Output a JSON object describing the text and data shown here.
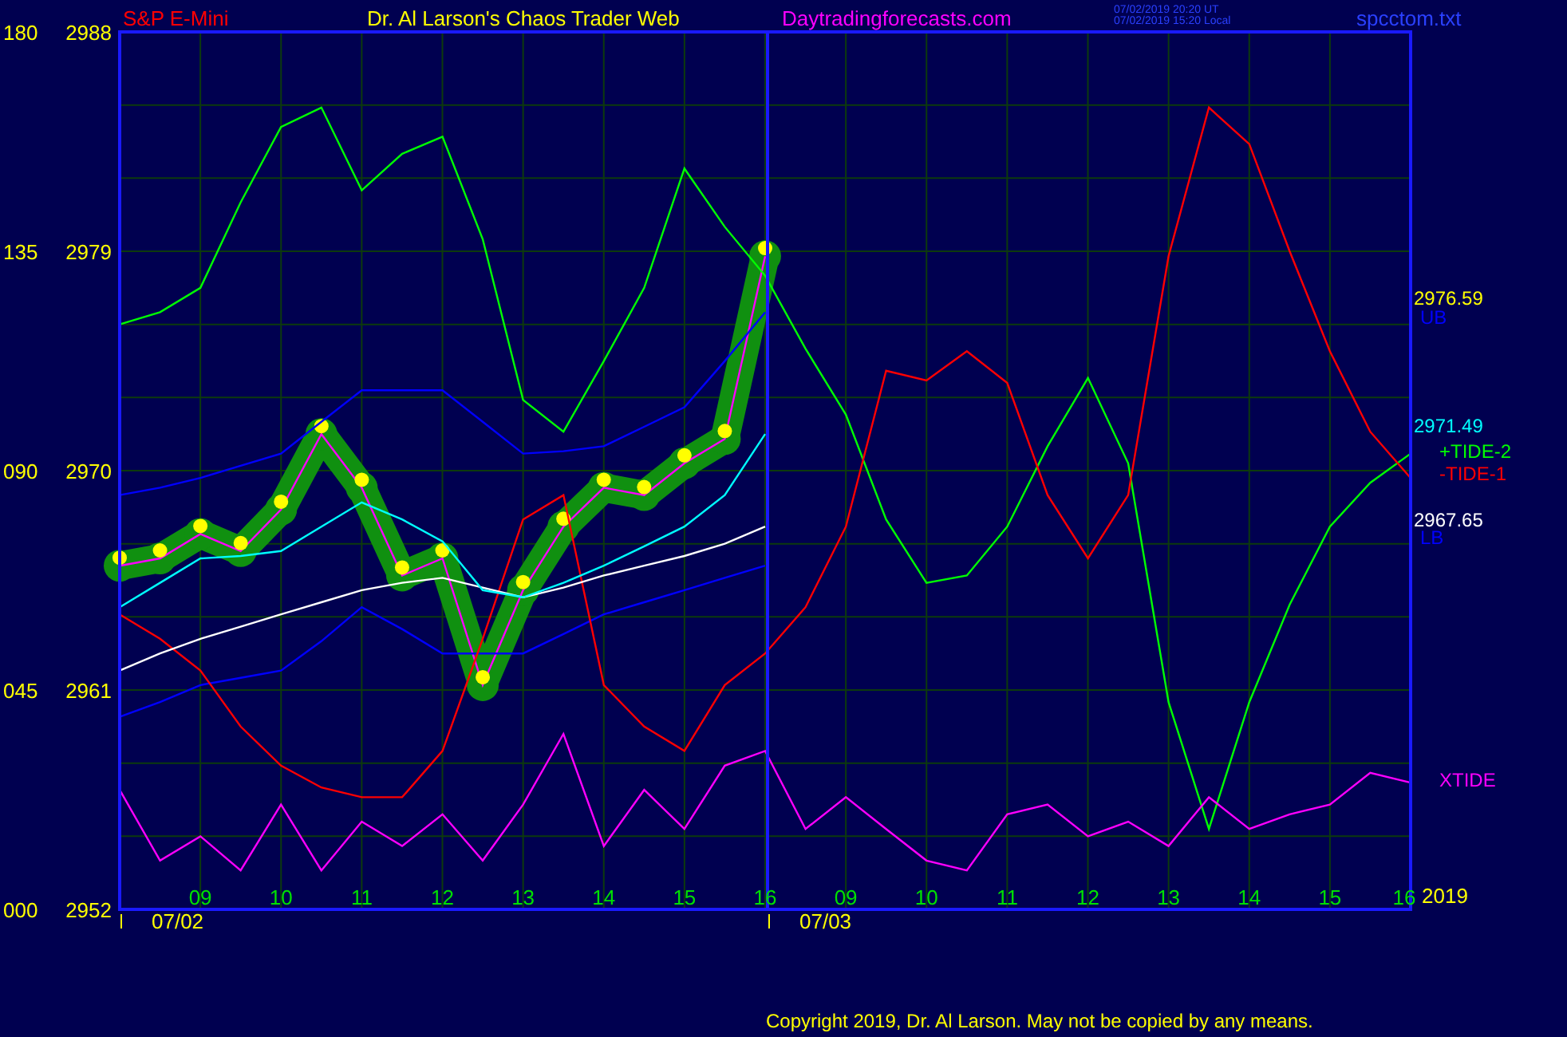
{
  "header": {
    "symbol": "S&P E-Mini",
    "title": "Dr. Al Larson's Chaos Trader Web",
    "site": "Daytradingforecasts.com",
    "times": [
      "07/02/2019 20:20 UT",
      "07/02/2019 15:20 Local"
    ],
    "file": "spcctom.txt"
  },
  "chart_data": {
    "type": "line",
    "ylim": [
      2952,
      2988
    ],
    "categories": [
      null,
      null,
      "09",
      null,
      "10",
      null,
      "11",
      null,
      "12",
      null,
      "13",
      null,
      "14",
      null,
      "15",
      null,
      "16",
      null,
      "09",
      null,
      "10",
      null,
      "11",
      null,
      "12",
      null,
      "13",
      null,
      "14",
      null,
      "15",
      null,
      "16"
    ],
    "yticks": [
      2952,
      2961,
      2970,
      2979,
      2988
    ],
    "grid": true,
    "series": [
      {
        "name": "UB",
        "color": "#0000ff",
        "values": [
          2969.0,
          2969.3,
          2969.7,
          2970.2,
          2970.7,
          2972,
          2973.3,
          2973.3,
          2973.3,
          2972.0,
          2970.7,
          2970.8,
          2971.0,
          2971.8,
          2972.6,
          2974.5,
          2976.5,
          null,
          null,
          null,
          null,
          null,
          null,
          null,
          null,
          null,
          null,
          null,
          null,
          null,
          null,
          null,
          null
        ]
      },
      {
        "name": "LB",
        "color": "#0000ff",
        "values": [
          2959.9,
          2960.5,
          2961.2,
          2961.5,
          2961.8,
          2963,
          2964.4,
          2963.5,
          2962.5,
          2962.5,
          2962.5,
          2963.3,
          2964.1,
          2964.6,
          2965.1,
          2965.6,
          2966.1,
          null,
          null,
          null,
          null,
          null,
          null,
          null,
          null,
          null,
          null,
          null,
          null,
          null,
          null,
          null,
          null
        ]
      },
      {
        "name": "+TIDE-2",
        "color": "#00ff00",
        "values": [
          2976.0,
          2976.5,
          2977.5,
          2981,
          2984.1,
          2984.9,
          2981.5,
          2983,
          2983.7,
          2979.5,
          2972.9,
          2971.6,
          2974.5,
          2977.5,
          2982.4,
          2980,
          2978,
          2975,
          2972.3,
          2968,
          2965.4,
          2965.7,
          2967.7,
          2971,
          2973.8,
          2970.3,
          2960.5,
          2955.3,
          2960.5,
          2964.5,
          2967.7,
          2969.5,
          2970.7
        ]
      },
      {
        "name": "-TIDE-1",
        "color": "#ff0000",
        "values": [
          2964.1,
          2963.1,
          2961.8,
          2959.5,
          2957.9,
          2957,
          2956.6,
          2956.6,
          2958.5,
          2963.1,
          2968.0,
          2969.0,
          2961.2,
          2959.5,
          2958.5,
          2961.2,
          2962.5,
          2964.4,
          2967.7,
          2974.1,
          2973.7,
          2974.9,
          2973.6,
          2969.0,
          2966.4,
          2969.0,
          2978.8,
          2984.9,
          2983.4,
          2979,
          2974.9,
          2971.6,
          2969.7
        ]
      },
      {
        "name": "XTIDE",
        "color": "#ff00ff",
        "values": [
          2956.9,
          2954.0,
          2955.0,
          2953.6,
          2956.3,
          2953.6,
          2955.6,
          2954.6,
          2955.9,
          2954.0,
          2956.3,
          2959.2,
          2954.6,
          2956.9,
          2955.3,
          2957.9,
          2958.5,
          2955.3,
          2956.6,
          2955.3,
          2954.0,
          2953.6,
          2955.9,
          2956.3,
          2955.0,
          2955.6,
          2954.6,
          2956.6,
          2955.3,
          2955.9,
          2956.3,
          2957.6,
          2957.2
        ]
      },
      {
        "color": "#ffffff",
        "values": [
          2961.8,
          2962.5,
          2963.1,
          2963.6,
          2964.1,
          2964.6,
          2965.1,
          2965.4,
          2965.6,
          2965.2,
          2964.8,
          2965.2,
          2965.7,
          2966.1,
          2966.5,
          2967,
          2967.7,
          null,
          null,
          null,
          null,
          null,
          null,
          null,
          null,
          null,
          null,
          null,
          null,
          null,
          null,
          null,
          null
        ]
      },
      {
        "color": "#00ffff",
        "values": [
          2964.4,
          2965.4,
          2966.4,
          2966.5,
          2966.7,
          2967.7,
          2968.7,
          2968,
          2967.1,
          2965.1,
          2964.8,
          2965.4,
          2966.1,
          2966.9,
          2967.7,
          2969,
          2971.5,
          null,
          null,
          null,
          null,
          null,
          null,
          null,
          null,
          null,
          null,
          null,
          null,
          null,
          null,
          null,
          null
        ]
      },
      {
        "color": "#ff00ff",
        "marker": "circle",
        "values": [
          2966.1,
          2966.4,
          2967.4,
          2966.7,
          2968.4,
          2971.5,
          2969.3,
          2965.7,
          2966.4,
          2961.2,
          2965.1,
          2967.7,
          2969.3,
          2969.0,
          2970.3,
          2971.3,
          2978.8,
          null,
          null,
          null,
          null,
          null,
          null,
          null,
          null,
          null,
          null,
          null,
          null,
          null,
          null,
          null,
          null
        ]
      }
    ]
  },
  "angle_scale": [
    "180",
    "135",
    "090",
    "045",
    "000"
  ],
  "dates": [
    "07/02",
    "07/03"
  ],
  "year": "2019",
  "readings": [
    {
      "text": "2976.59",
      "color": "#ffff00"
    },
    {
      "text": "2971.49",
      "color": "#00ffff"
    },
    {
      "text": "2967.65",
      "color": "#ffffff"
    }
  ],
  "copyright": "Copyright 2019, Dr. Al Larson. May not be copied by any means."
}
